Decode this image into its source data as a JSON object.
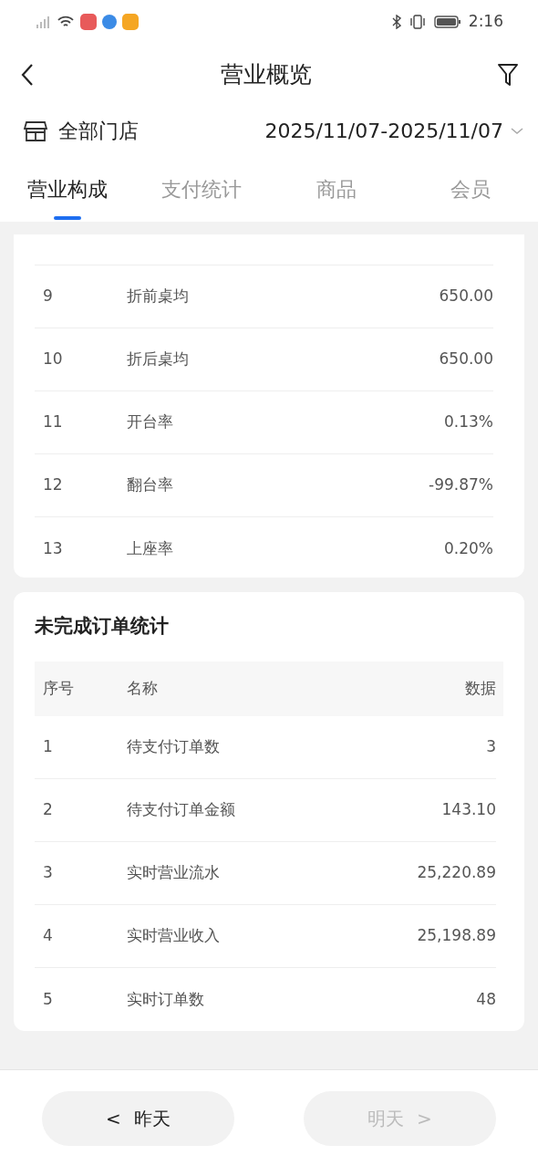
{
  "status_bar": {
    "time": "2:16"
  },
  "header": {
    "title": "营业概览"
  },
  "store_bar": {
    "store": "全部门店",
    "date_range": "2025/11/07-2025/11/07"
  },
  "tabs": [
    {
      "label": "营业构成",
      "selected": true
    },
    {
      "label": "支付统计",
      "selected": false
    },
    {
      "label": "商品",
      "selected": false
    },
    {
      "label": "会员",
      "selected": false
    }
  ],
  "stats_table": {
    "rows": [
      {
        "index": "9",
        "name": "折前桌均",
        "value": "650.00"
      },
      {
        "index": "10",
        "name": "折后桌均",
        "value": "650.00"
      },
      {
        "index": "11",
        "name": "开台率",
        "value": "0.13%"
      },
      {
        "index": "12",
        "name": "翻台率",
        "value": "-99.87%"
      },
      {
        "index": "13",
        "name": "上座率",
        "value": "0.20%"
      }
    ]
  },
  "pending_orders": {
    "title": "未完成订单统计",
    "columns": [
      "序号",
      "名称",
      "数据"
    ],
    "rows": [
      {
        "index": "1",
        "name": "待支付订单数",
        "value": "3"
      },
      {
        "index": "2",
        "name": "待支付订单金额",
        "value": "143.10"
      },
      {
        "index": "3",
        "name": "实时营业流水",
        "value": "25,220.89"
      },
      {
        "index": "4",
        "name": "实时营业收入",
        "value": "25,198.89"
      },
      {
        "index": "5",
        "name": "实时订单数",
        "value": "48"
      }
    ]
  },
  "footer": {
    "buttons": [
      {
        "label": "昨天",
        "arrow": "<",
        "disabled": false,
        "kind": "prev"
      },
      {
        "label": "明天",
        "arrow": ">",
        "disabled": true,
        "kind": "next"
      }
    ]
  }
}
